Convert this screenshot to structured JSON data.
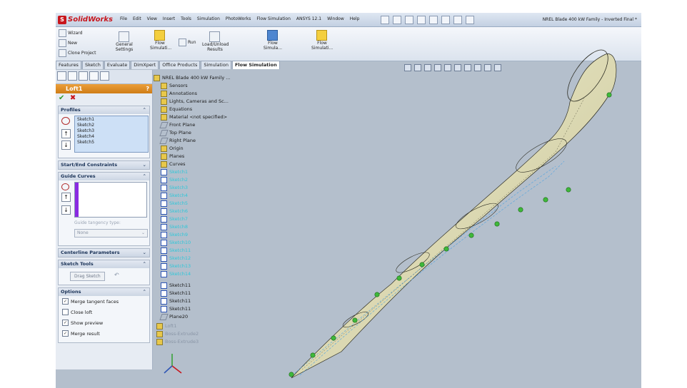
{
  "app": {
    "brand": "SolidWorks",
    "doc_title": "NREL Blade 400 kW Family - Inverted Final *"
  },
  "menu": [
    "File",
    "Edit",
    "View",
    "Insert",
    "Tools",
    "Simulation",
    "PhotoWorks",
    "Flow Simulation",
    "ANSYS 12.1",
    "Window",
    "Help"
  ],
  "ribbon": {
    "wizard": "Wizard",
    "new": "New",
    "clone": "Clone Project",
    "general_settings": "General Settings",
    "flow_sim1": "Flow Simulati...",
    "run": "Run",
    "load_unload": "Load/Unload Results",
    "flow_sim2": "Flow Simula...",
    "flow_sim3": "Flow Simulati..."
  },
  "tabs": [
    "Features",
    "Sketch",
    "Evaluate",
    "DimXpert",
    "Office Products",
    "Simulation",
    "Flow Simulation"
  ],
  "feature": {
    "title": "Loft1",
    "help": "?"
  },
  "sections": {
    "profiles": "Profiles",
    "start_end": "Start/End Constraints",
    "guide_curves": "Guide Curves",
    "guide_tangency": "Guide tangency type:",
    "guide_tangency_value": "None",
    "centerline": "Centerline Parameters",
    "sketch_tools": "Sketch Tools",
    "drag_sketch": "Drag Sketch",
    "options": "Options"
  },
  "profiles": [
    "Sketch1",
    "Sketch2",
    "Sketch3",
    "Sketch4",
    "Sketch5"
  ],
  "options": [
    {
      "label": "Merge tangent faces",
      "checked": true
    },
    {
      "label": "Close loft",
      "checked": false
    },
    {
      "label": "Show preview",
      "checked": true
    },
    {
      "label": "Merge result",
      "checked": true
    }
  ],
  "tree": {
    "root": "NREL Blade 400 kW Family ...",
    "top": [
      "Sensors",
      "Annotations",
      "Lights, Cameras and Sc...",
      "Equations",
      "Material <not specified>",
      "Front Plane",
      "Top Plane",
      "Right Plane",
      "Origin",
      "Planes",
      "Curves"
    ],
    "sketches_cyan": [
      "Sketch1",
      "Sketch2",
      "Sketch3",
      "Sketch4",
      "Sketch5",
      "Sketch6",
      "Sketch7",
      "Sketch8",
      "Sketch9",
      "Sketch10",
      "Sketch11",
      "Sketch12",
      "Sketch13",
      "Sketch14"
    ],
    "bottom": [
      "Sketch11",
      "Sketch11",
      "Sketch11",
      "Sketch11",
      "Plane20"
    ],
    "grey": [
      "Loft1",
      "Boss-Extrude2",
      "Boss-Extrude3"
    ]
  },
  "colors": {
    "accent_orange": "#d98420",
    "ok_green": "#2f9a2a",
    "cancel_red": "#c8161d",
    "viewport": "#b4bfcc",
    "blade_surface": "#e4e1b8",
    "point_green": "#3fb83a"
  }
}
